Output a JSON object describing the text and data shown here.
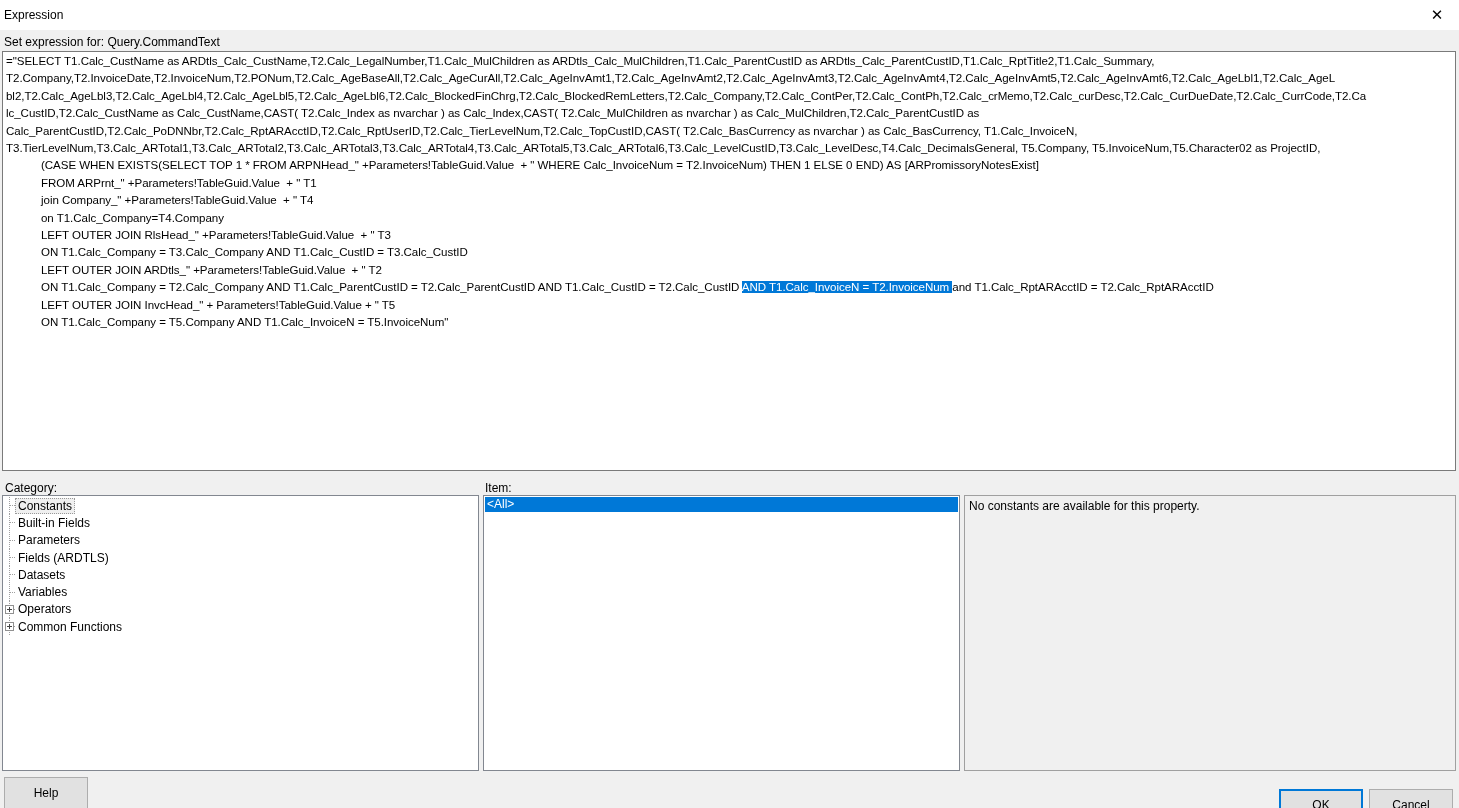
{
  "window": {
    "title": "Expression",
    "close": "✕"
  },
  "expression_label": "Set expression for: Query.CommandText",
  "expression_lines": [
    {
      "kind": "plain",
      "segments": [
        {
          "text": "=\"SELECT T1.Calc_CustName as ARDtls_Calc_CustName,T2.Calc_LegalNumber,T1.Calc_MulChildren as ARDtls_Calc_MulChildren,T1.Calc_ParentCustID as ARDtls_Calc_ParentCustID,T1.Calc_RptTitle2,T1.Calc_Summary,",
          "selected": false
        }
      ]
    },
    {
      "kind": "plain",
      "segments": [
        {
          "text": "T2.Company,T2.InvoiceDate,T2.InvoiceNum,T2.PONum,T2.Calc_AgeBaseAll,T2.Calc_AgeCurAll,T2.Calc_AgeInvAmt1,T2.Calc_AgeInvAmt2,T2.Calc_AgeInvAmt3,T2.Calc_AgeInvAmt4,T2.Calc_AgeInvAmt5,T2.Calc_AgeInvAmt6,T2.Calc_AgeLbl1,T2.Calc_AgeL",
          "selected": false
        }
      ]
    },
    {
      "kind": "plain",
      "segments": [
        {
          "text": "bl2,T2.Calc_AgeLbl3,T2.Calc_AgeLbl4,T2.Calc_AgeLbl5,T2.Calc_AgeLbl6,T2.Calc_BlockedFinChrg,T2.Calc_BlockedRemLetters,T2.Calc_Company,T2.Calc_ContPer,T2.Calc_ContPh,T2.Calc_crMemo,T2.Calc_curDesc,T2.Calc_CurDueDate,T2.Calc_CurrCode,T2.Ca",
          "selected": false
        }
      ]
    },
    {
      "kind": "plain",
      "segments": [
        {
          "text": "lc_CustID,T2.Calc_CustName as Calc_CustName,CAST( T2.Calc_Index as nvarchar ) as Calc_Index,CAST( T2.Calc_MulChildren as nvarchar ) as Calc_MulChildren,T2.Calc_ParentCustID as",
          "selected": false
        }
      ]
    },
    {
      "kind": "plain",
      "segments": [
        {
          "text": "Calc_ParentCustID,T2.Calc_PoDNNbr,T2.Calc_RptARAcctID,T2.Calc_RptUserID,T2.Calc_TierLevelNum,T2.Calc_TopCustID,CAST( T2.Calc_BasCurrency as nvarchar ) as Calc_BasCurrency, T1.Calc_InvoiceN,",
          "selected": false
        }
      ]
    },
    {
      "kind": "plain",
      "segments": [
        {
          "text": "T3.TierLevelNum,T3.Calc_ARTotal1,T3.Calc_ARTotal2,T3.Calc_ARTotal3,T3.Calc_ARTotal4,T3.Calc_ARTotal5,T3.Calc_ARTotal6,T3.Calc_LevelCustID,T3.Calc_LevelDesc,T4.Calc_DecimalsGeneral, T5.Company, T5.InvoiceNum,T5.Character02 as ProjectID,",
          "selected": false
        }
      ]
    },
    {
      "kind": "indented",
      "segments": [
        {
          "text": "(CASE WHEN EXISTS(SELECT TOP 1 * FROM ARPNHead_\" +Parameters!TableGuid.Value  + \" WHERE Calc_InvoiceNum = T2.InvoiceNum) THEN 1 ELSE 0 END) AS [ARPromissoryNotesExist]",
          "selected": false
        }
      ]
    },
    {
      "kind": "indented",
      "segments": [
        {
          "text": "FROM ARPrnt_\" +Parameters!TableGuid.Value  + \" T1",
          "selected": false
        }
      ]
    },
    {
      "kind": "indented",
      "segments": [
        {
          "text": "join Company_\" +Parameters!TableGuid.Value  + \" T4",
          "selected": false
        }
      ]
    },
    {
      "kind": "indented",
      "segments": [
        {
          "text": "on T1.Calc_Company=T4.Company",
          "selected": false
        }
      ]
    },
    {
      "kind": "indented",
      "segments": [
        {
          "text": "LEFT OUTER JOIN RlsHead_\" +Parameters!TableGuid.Value  + \" T3",
          "selected": false
        }
      ]
    },
    {
      "kind": "indented",
      "segments": [
        {
          "text": "ON T1.Calc_Company = T3.Calc_Company AND T1.Calc_CustID = T3.Calc_CustID",
          "selected": false
        }
      ]
    },
    {
      "kind": "indented",
      "segments": [
        {
          "text": "LEFT OUTER JOIN ARDtls_\" +Parameters!TableGuid.Value  + \" T2",
          "selected": false
        }
      ]
    },
    {
      "kind": "indented",
      "segments": [
        {
          "text": "ON T1.Calc_Company = T2.Calc_Company AND T1.Calc_ParentCustID = T2.Calc_ParentCustID AND T1.Calc_CustID = T2.Calc_CustID ",
          "selected": false
        },
        {
          "text": "AND T1.Calc_InvoiceN = T2.InvoiceNum ",
          "selected": true
        },
        {
          "text": "and T1.Calc_RptARAcctID = T2.Calc_RptARAcctID",
          "selected": false
        }
      ]
    },
    {
      "kind": "indented",
      "segments": [
        {
          "text": "LEFT OUTER JOIN InvcHead_\" + Parameters!TableGuid.Value + \" T5",
          "selected": false
        }
      ]
    },
    {
      "kind": "indented",
      "segments": [
        {
          "text": "ON T1.Calc_Company = T5.Company AND T1.Calc_InvoiceN = T5.InvoiceNum\"",
          "selected": false
        }
      ]
    }
  ],
  "category": {
    "label": "Category:",
    "items": [
      {
        "label": "Constants",
        "selected": true,
        "expandable": false
      },
      {
        "label": "Built-in Fields",
        "selected": false,
        "expandable": false
      },
      {
        "label": "Parameters",
        "selected": false,
        "expandable": false
      },
      {
        "label": "Fields (ARDTLS)",
        "selected": false,
        "expandable": false
      },
      {
        "label": "Datasets",
        "selected": false,
        "expandable": false
      },
      {
        "label": "Variables",
        "selected": false,
        "expandable": false
      },
      {
        "label": "Operators",
        "selected": false,
        "expandable": true
      },
      {
        "label": "Common Functions",
        "selected": false,
        "expandable": true
      }
    ]
  },
  "item": {
    "label": "Item:",
    "items": [
      {
        "label": "<All>",
        "selected": true
      }
    ]
  },
  "description": "No constants are available for this property.",
  "help_button": {
    "label": "Help"
  },
  "buttons": [
    {
      "label": "OK",
      "default": true
    },
    {
      "label": "Cancel",
      "default": false
    }
  ]
}
